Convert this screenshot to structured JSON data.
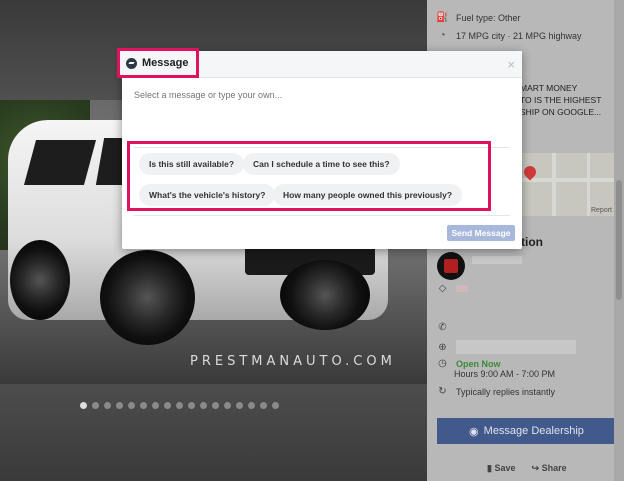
{
  "listing": {
    "fuel_type": "Fuel type: Other",
    "mpg": "17 MPG city · 21 MPG highway",
    "description_lines": [
      "MART MONEY",
      "TO IS THE HIGHEST",
      "SHIP ON GOOGLE..."
    ],
    "section_title": "tion",
    "open_now": "Open Now",
    "hours": "Hours 9:00 AM - 7:00 PM",
    "reply_time": "Typically replies instantly",
    "message_dealership": "Message Dealership",
    "save": "Save",
    "share": "Share",
    "map_report": "Report"
  },
  "gallery": {
    "watermark": "PRESTMANAUTO.COM",
    "dot_count": 17,
    "active_dot": 0
  },
  "modal": {
    "title": "Message",
    "close": "×",
    "input_placeholder": "Select a message or type your own...",
    "suggestions": [
      "Is this still available?",
      "Can I schedule a time to see this?",
      "What's the vehicle's history?",
      "How many people owned this previously?"
    ],
    "send_label": "Send Message"
  },
  "colors": {
    "highlight": "#e0115f",
    "fb_blue": "#42598b",
    "send_disabled": "#a7b8dc"
  }
}
